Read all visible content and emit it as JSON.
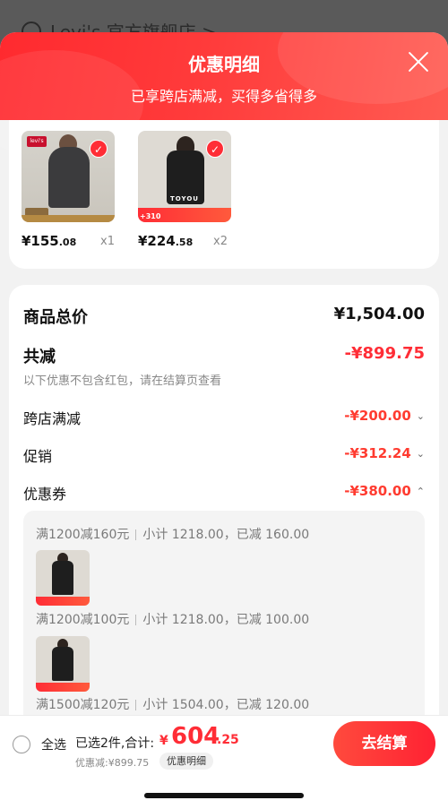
{
  "store": {
    "name": "Levi's 官方旗舰店 >"
  },
  "sheet": {
    "title": "优惠明细",
    "subtitle": "已享跨店满减，买得多省得多",
    "close_icon": "close-icon"
  },
  "products": [
    {
      "image": "hoodie-model-photo",
      "logo_text": "levi's",
      "price_int": "¥155",
      "price_dec": ".08",
      "qty": "x1",
      "selected": true
    },
    {
      "image": "coat-model-photo",
      "brand_text": "TOYOU",
      "promo_amount": "+310",
      "price_int": "¥224",
      "price_dec": ".58",
      "qty": "x2",
      "selected": true
    }
  ],
  "summary": {
    "total_label": "商品总价",
    "total_value": "¥1,504.00",
    "reduce_label": "共减",
    "reduce_value": "-¥899.75",
    "note": "以下优惠不包含红包，请在结算页查看",
    "items": [
      {
        "label": "跨店满减",
        "value": "-¥200.00",
        "chevron": "chevron-down-icon"
      },
      {
        "label": "促销",
        "value": "-¥312.24",
        "chevron": "chevron-down-icon"
      },
      {
        "label": "优惠券",
        "value": "-¥380.00",
        "chevron": "chevron-up-icon"
      }
    ]
  },
  "coupons": [
    {
      "rule": "满1200减160元",
      "subtotal": "小计 1218.00，已减 160.00"
    },
    {
      "rule": "满1200减100元",
      "subtotal": "小计 1218.00，已减 100.00"
    },
    {
      "rule": "满1500减120元",
      "subtotal": "小计 1504.00，已减 120.00"
    }
  ],
  "bottom": {
    "select_all": "全选",
    "selected_text": "已选2件,合计:",
    "total_yen": "¥",
    "total_main": "604",
    "total_dec": ".25",
    "discount_text": "优惠减:¥899.75",
    "detail_pill": "优惠明细",
    "checkout": "去结算"
  },
  "colors": {
    "accent": "#ff2d36",
    "header_gradient_start": "#ff2a2f",
    "header_gradient_end": "#ff5b52"
  }
}
